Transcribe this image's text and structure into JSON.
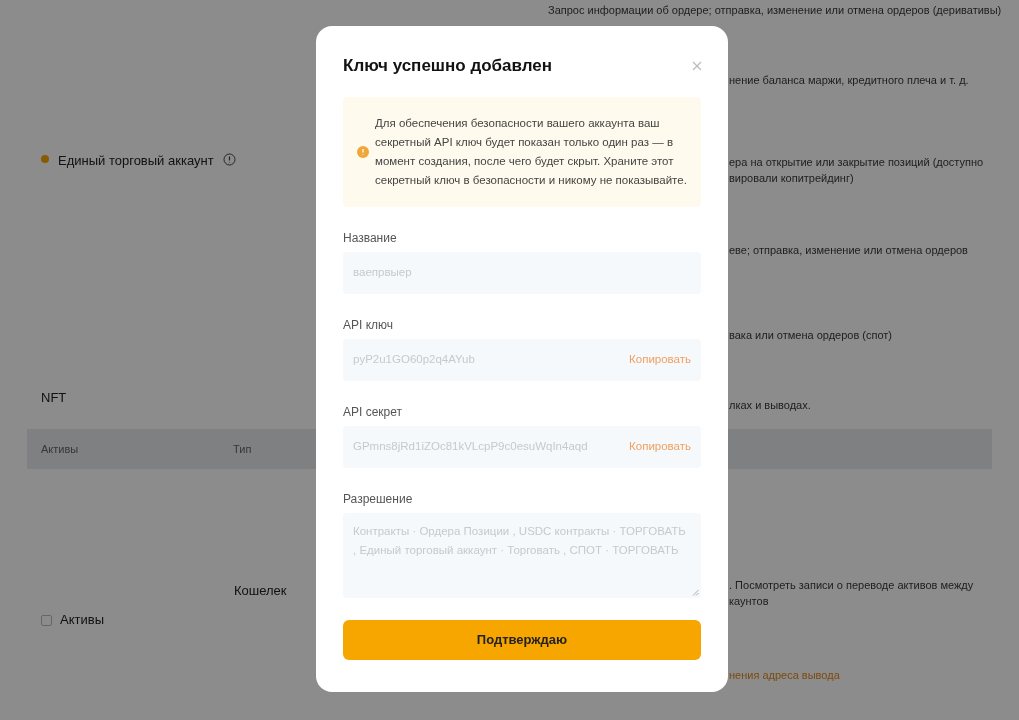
{
  "background": {
    "top_note": "Запрос информации об ордере; отправка, изменение или отмена ордеров (деривативы)",
    "margin_note": "нение баланса маржи, кредитного плеча и т. д.",
    "account_option": {
      "label": "Единый торговый аккаунт",
      "selected": true
    },
    "account_note_lines": [
      "ера на открытие или закрытие позиций (доступно",
      "вировали копитрейдинг)"
    ],
    "usdc_note": "еве; отправка, изменение или отмена ордеров",
    "spot_note": "вака или отмена ордеров (спот)",
    "nft_title": "NFT",
    "nft_note": "лках и выводах.",
    "table_columns": [
      "Активы",
      "Тип"
    ],
    "wallet_label": "Кошелек",
    "wallet_note_lines": [
      ". Посмотреть записи о переводе активов между",
      "каунтов"
    ],
    "assets_checkbox": {
      "label": "Активы",
      "checked": false
    },
    "withdraw_link": "нения адреса вывода"
  },
  "modal": {
    "title": "Ключ успешно добавлен",
    "notice": "Для обеспечения безопасности вашего аккаунта ваш секретный API ключ будет показан только один раз — в момент создания, после чего будет скрыт. Храните этот секретный ключ в безопасности и никому не показывайте.",
    "fields": [
      {
        "kind": "input",
        "label": "Название",
        "value": "ваепрвыер"
      },
      {
        "kind": "input",
        "label": "API ключ",
        "value": "pyP2u1GO60p2q4AYub",
        "action": "Копировать"
      },
      {
        "kind": "input",
        "label": "API секрет",
        "value": "GPmns8jRd1iZOc81kVLcpP9c0esuWqIn4aqd",
        "action": "Копировать"
      },
      {
        "kind": "textarea",
        "label": "Разрешение",
        "value": "Контракты · Ордера Позиции  , USDC контракты · ТОРГОВАТЬ  , Единый торговый аккаунт · Торговать  , СПОТ · ТОРГОВАТЬ"
      }
    ],
    "confirm_button": "Подтверждаю"
  }
}
